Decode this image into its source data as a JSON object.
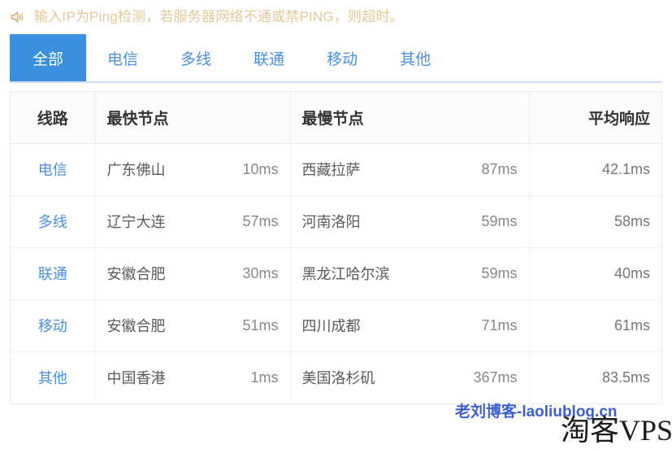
{
  "notice": {
    "icon": "speaker-icon",
    "text": "输入IP为Ping检测，若服务器网络不通或禁PING，则超时。",
    "color": "#e3c89a"
  },
  "tabs": {
    "active_index": 0,
    "active_color": "#3b8fdd",
    "link_color": "#4a90e2",
    "items": [
      {
        "label": "全部",
        "active": true
      },
      {
        "label": "电信",
        "active": false
      },
      {
        "label": "多线",
        "active": false
      },
      {
        "label": "联通",
        "active": false
      },
      {
        "label": "移动",
        "active": false
      },
      {
        "label": "其他",
        "active": false
      }
    ]
  },
  "table": {
    "headers": {
      "line": "线路",
      "fastest": "最快节点",
      "slowest": "最慢节点",
      "average": "平均响应"
    },
    "rows": [
      {
        "line": "电信",
        "fastest_node": "广东佛山",
        "fastest_ms": "10ms",
        "slowest_node": "西藏拉萨",
        "slowest_ms": "87ms",
        "average_ms": "42.1ms"
      },
      {
        "line": "多线",
        "fastest_node": "辽宁大连",
        "fastest_ms": "57ms",
        "slowest_node": "河南洛阳",
        "slowest_ms": "59ms",
        "average_ms": "58ms"
      },
      {
        "line": "联通",
        "fastest_node": "安徽合肥",
        "fastest_ms": "30ms",
        "slowest_node": "黑龙江哈尔滨",
        "slowest_ms": "59ms",
        "average_ms": "40ms"
      },
      {
        "line": "移动",
        "fastest_node": "安徽合肥",
        "fastest_ms": "51ms",
        "slowest_node": "四川成都",
        "slowest_ms": "71ms",
        "average_ms": "61ms"
      },
      {
        "line": "其他",
        "fastest_node": "中国香港",
        "fastest_ms": "1ms",
        "slowest_node": "美国洛杉矶",
        "slowest_ms": "367ms",
        "average_ms": "83.5ms"
      }
    ]
  },
  "watermarks": {
    "blog": "老刘博客-laoliublog.cn",
    "blog_color": "#3f5fd0",
    "brand": "淘客VPS",
    "brand_color": "#1c1c1c"
  }
}
